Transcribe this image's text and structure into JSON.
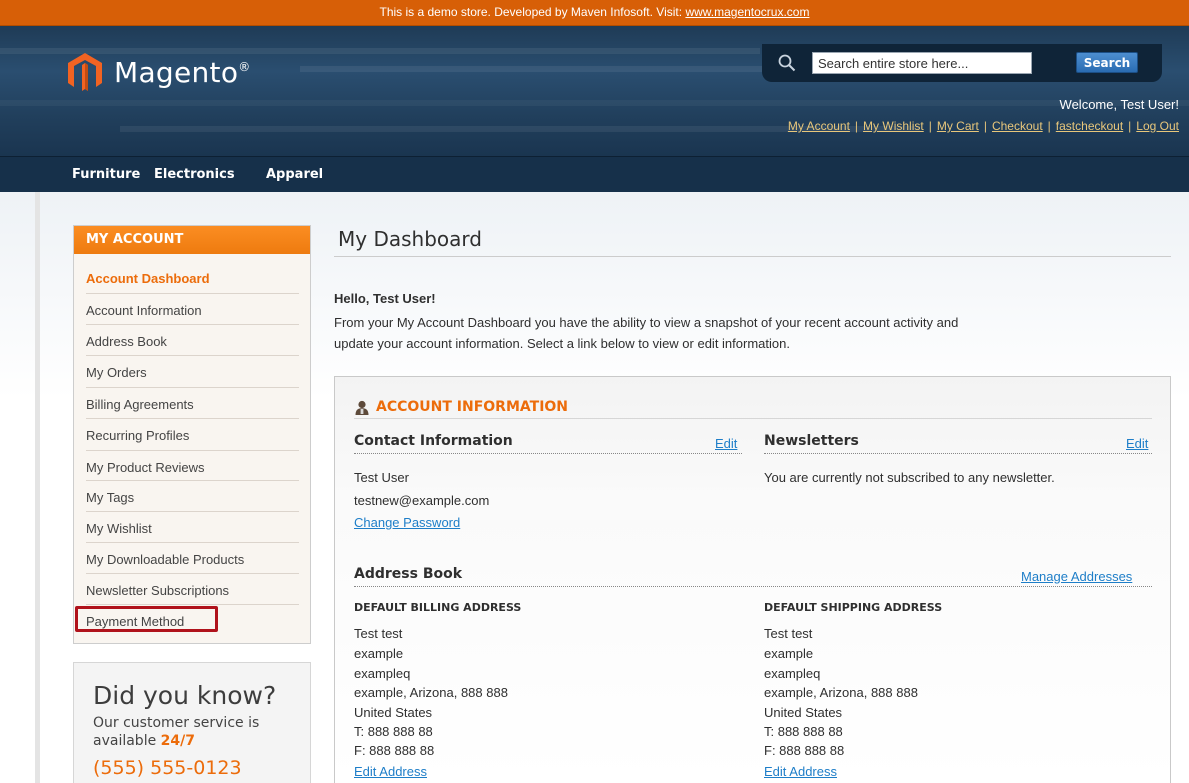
{
  "demo_bar": {
    "text": "This is a demo store. Developed by Maven Infosoft. Visit:",
    "link": "www.magentocrux.com"
  },
  "header": {
    "logo_text": "Magento",
    "logo_reg": "®",
    "search_placeholder": "Search entire store here...",
    "search_button": "Search",
    "welcome": "Welcome, Test User!",
    "top_links": [
      "My Account",
      "My Wishlist",
      "My Cart",
      "Checkout",
      "fastcheckout",
      "Log Out"
    ],
    "separator": "|"
  },
  "nav": [
    "Furniture",
    "Electronics",
    "Apparel"
  ],
  "sidebar": {
    "title": "MY ACCOUNT",
    "items": [
      "Account Dashboard",
      "Account Information",
      "Address Book",
      "My Orders",
      "Billing Agreements",
      "Recurring Profiles",
      "My Product Reviews",
      "My Tags",
      "My Wishlist",
      "My Downloadable Products",
      "Newsletter Subscriptions",
      "Payment Method"
    ],
    "active_index": 0,
    "highlighted_index": 11
  },
  "did_you_know": {
    "title": "Did you know?",
    "line1": "Our customer service is",
    "line2_prefix": "available",
    "line2_highlight": "24/7",
    "phone": "(555) 555-0123"
  },
  "main": {
    "title": "My Dashboard",
    "hello": "Hello, Test User!",
    "intro_line1": "From your My Account Dashboard you have the ability to view a snapshot of your recent account activity and",
    "intro_line2": "update your account information. Select a link below to view or edit information.",
    "account_info_title": "ACCOUNT INFORMATION",
    "contact": {
      "title": "Contact Information",
      "edit": "Edit",
      "name": "Test User",
      "email": "testnew@example.com",
      "change_password": "Change Password"
    },
    "newsletters": {
      "title": "Newsletters",
      "edit": "Edit",
      "status": "You are currently not subscribed to any newsletter."
    },
    "address_book": {
      "title": "Address Book",
      "manage": "Manage Addresses",
      "billing": {
        "title": "DEFAULT BILLING ADDRESS",
        "lines": [
          "Test test",
          "example",
          "exampleq",
          "example, Arizona, 888 888",
          "United States",
          "T: 888 888 88",
          "F: 888 888 88"
        ],
        "edit": "Edit Address"
      },
      "shipping": {
        "title": "DEFAULT SHIPPING ADDRESS",
        "lines": [
          "Test test",
          "example",
          "exampleq",
          "example, Arizona, 888 888",
          "United States",
          "T: 888 888 88",
          "F: 888 888 88"
        ],
        "edit": "Edit Address"
      }
    }
  },
  "colors": {
    "accent": "#ec6c0b",
    "demo_bar": "#d75f07",
    "header": "#24476a",
    "link": "#1e7ec8",
    "highlight_box": "#b0121b"
  }
}
